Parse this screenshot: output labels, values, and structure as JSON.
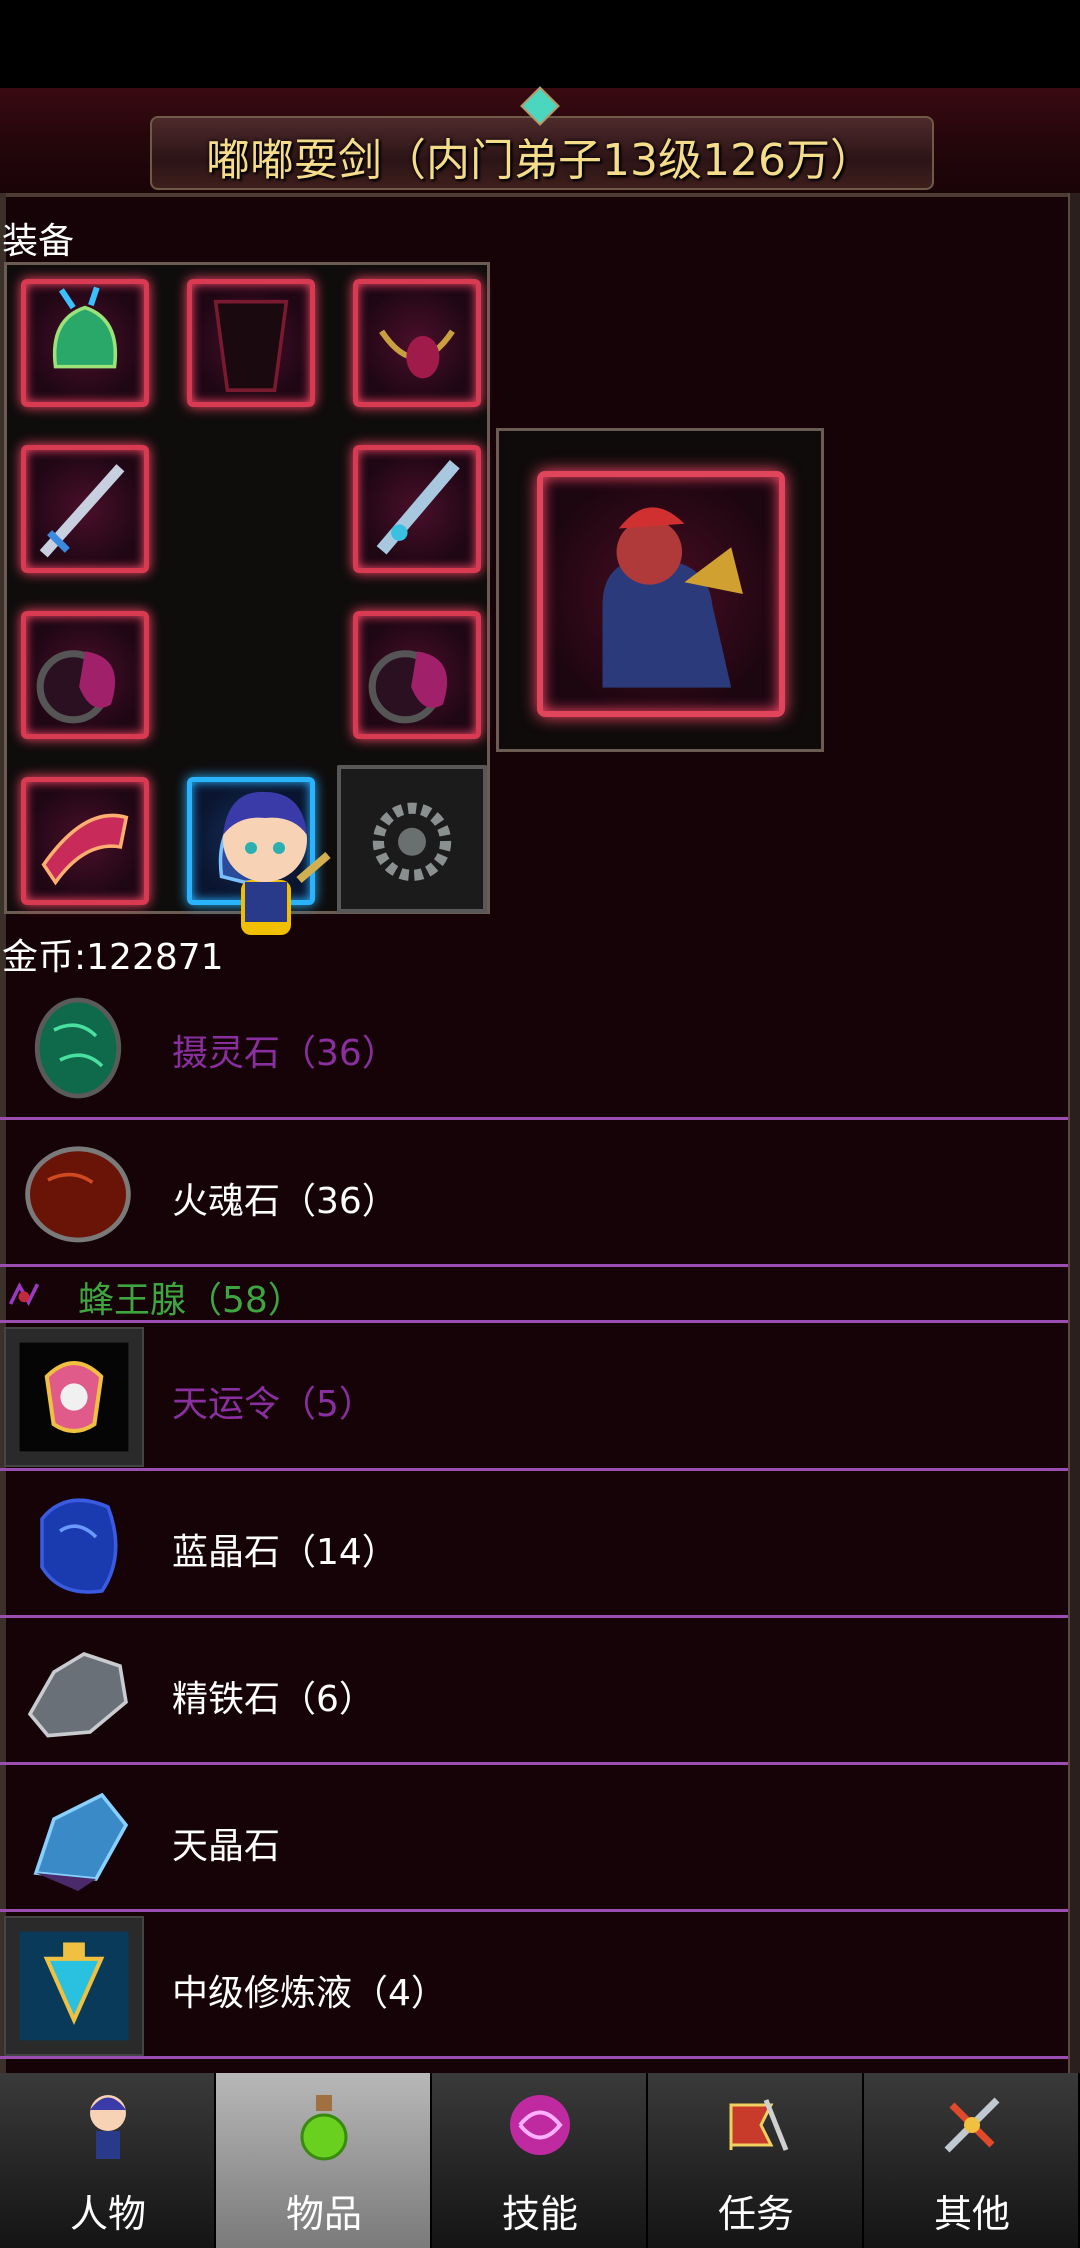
{
  "header": {
    "title": "嘟嘟耍剑（内门弟子13级126万）"
  },
  "equipment": {
    "section_label": "装备"
  },
  "gold": {
    "label": "金币:122871"
  },
  "items": [
    {
      "name": "摄灵石（36）",
      "color": "#8a2fa0",
      "icon": "green-stone-icon"
    },
    {
      "name": "火魂石（36）",
      "color": "#ffffff",
      "icon": "red-stone-icon"
    },
    {
      "name": "蜂王腺（58）",
      "color": "#3fa63f",
      "icon": "bee-gland-icon"
    },
    {
      "name": "天运令（5）",
      "color": "#8a2fa0",
      "icon": "fortune-token-icon"
    },
    {
      "name": "蓝晶石（14）",
      "color": "#ffffff",
      "icon": "blue-crystal-icon"
    },
    {
      "name": "精铁石（6）",
      "color": "#ffffff",
      "icon": "iron-ore-icon"
    },
    {
      "name": "天晶石",
      "color": "#ffffff",
      "icon": "sky-crystal-icon"
    },
    {
      "name": "中级修炼液（4）",
      "color": "#ffffff",
      "icon": "training-liquid-icon"
    }
  ],
  "tabs": [
    {
      "label": "人物",
      "icon": "character-icon",
      "active": false
    },
    {
      "label": "物品",
      "icon": "potion-icon",
      "active": true
    },
    {
      "label": "技能",
      "icon": "skill-orb-icon",
      "active": false
    },
    {
      "label": "任务",
      "icon": "quest-banner-icon",
      "active": false
    },
    {
      "label": "其他",
      "icon": "crossed-swords-icon",
      "active": false
    }
  ]
}
